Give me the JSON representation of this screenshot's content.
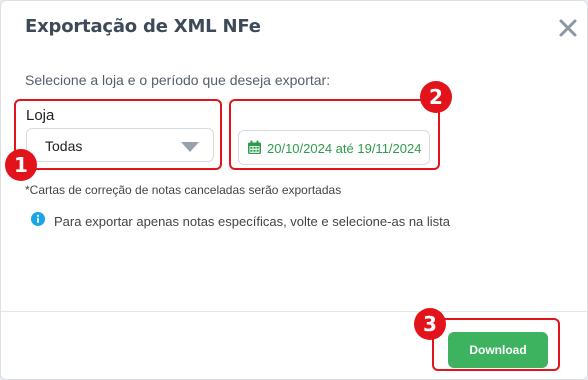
{
  "modal": {
    "title": "Exportação de XML NFe",
    "close_icon": "close-icon"
  },
  "form": {
    "instruction": "Selecione a loja e o período que deseja exportar:",
    "store_label": "Loja",
    "store_value": "Todas",
    "date_range": "20/10/2024 até 19/11/2024",
    "calendar_icon": "calendar-icon",
    "note": "*Cartas de correção de notas canceladas serão exportadas",
    "info_icon": "info-icon",
    "info_text": "Para exportar apenas notas específicas, volte e selecione-as na lista"
  },
  "footer": {
    "download_label": "Download"
  },
  "annotations": {
    "badges": [
      "1",
      "2",
      "3"
    ],
    "highlight_color": "#e3131b"
  },
  "colors": {
    "accent_green": "#3db35f",
    "date_text": "#2f9b4c",
    "info_blue": "#1aa6e6"
  }
}
